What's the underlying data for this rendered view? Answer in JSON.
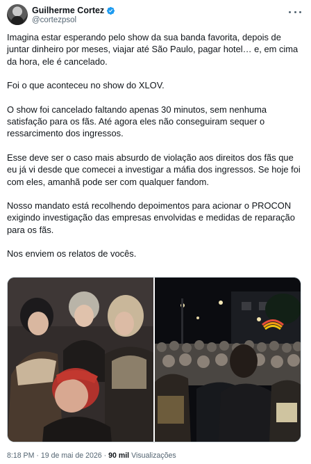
{
  "author": {
    "display_name": "Guilherme Cortez",
    "handle": "@cortezpsol",
    "verified": true,
    "verified_color": "#1d9bf0"
  },
  "tweet": {
    "paragraphs": [
      "Imagina estar esperando pelo show da sua banda favorita, depois de juntar dinheiro por meses, viajar até São Paulo, pagar hotel… e, em cima da hora, ele é cancelado.",
      "Foi o que aconteceu no show do XLOV.",
      "O show foi cancelado faltando apenas 30 minutos, sem nenhuma satisfação para os fãs. Até agora eles não conseguiram sequer o ressarcimento dos ingressos.",
      "Esse deve ser o caso mais absurdo de violação aos direitos dos fãs que eu já vi desde que comecei a investigar a máfia dos ingressos. Se hoje foi com eles, amanhã pode ser com qualquer fandom.",
      "Nosso mandato está recolhendo depoimentos para acionar o PROCON exigindo investigação das empresas envolvidas e medidas de reparação para os fãs.",
      "Nos enviem os relatos de vocês."
    ]
  },
  "footer": {
    "time": "8:18 PM",
    "separator": "·",
    "date": "19 de mai de 2026",
    "views_count": "90 mil",
    "views_label": "Visualizações"
  },
  "icons": {
    "more": "more-options-icon",
    "verified": "verified-badge-icon"
  }
}
